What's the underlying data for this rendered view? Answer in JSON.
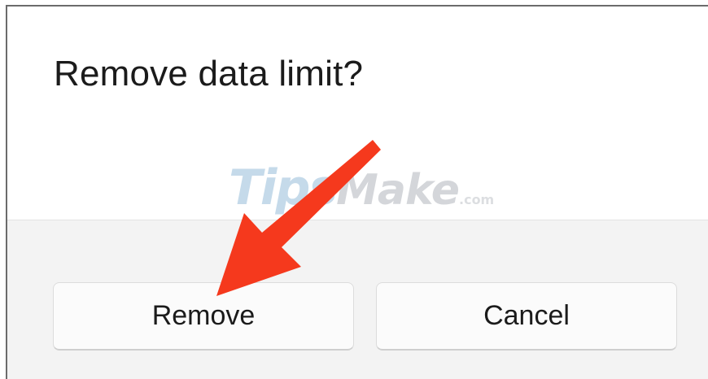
{
  "dialog": {
    "title": "Remove data limit?",
    "buttons": {
      "remove_label": "Remove",
      "cancel_label": "Cancel"
    }
  },
  "watermark": {
    "tips": "Tips",
    "make": "Make",
    "com": ".com"
  },
  "colors": {
    "arrow": "#f5391d",
    "footer_background": "#f3f3f3",
    "button_background": "#fbfbfb"
  },
  "icons": {
    "annotation": "red-arrow-icon"
  }
}
